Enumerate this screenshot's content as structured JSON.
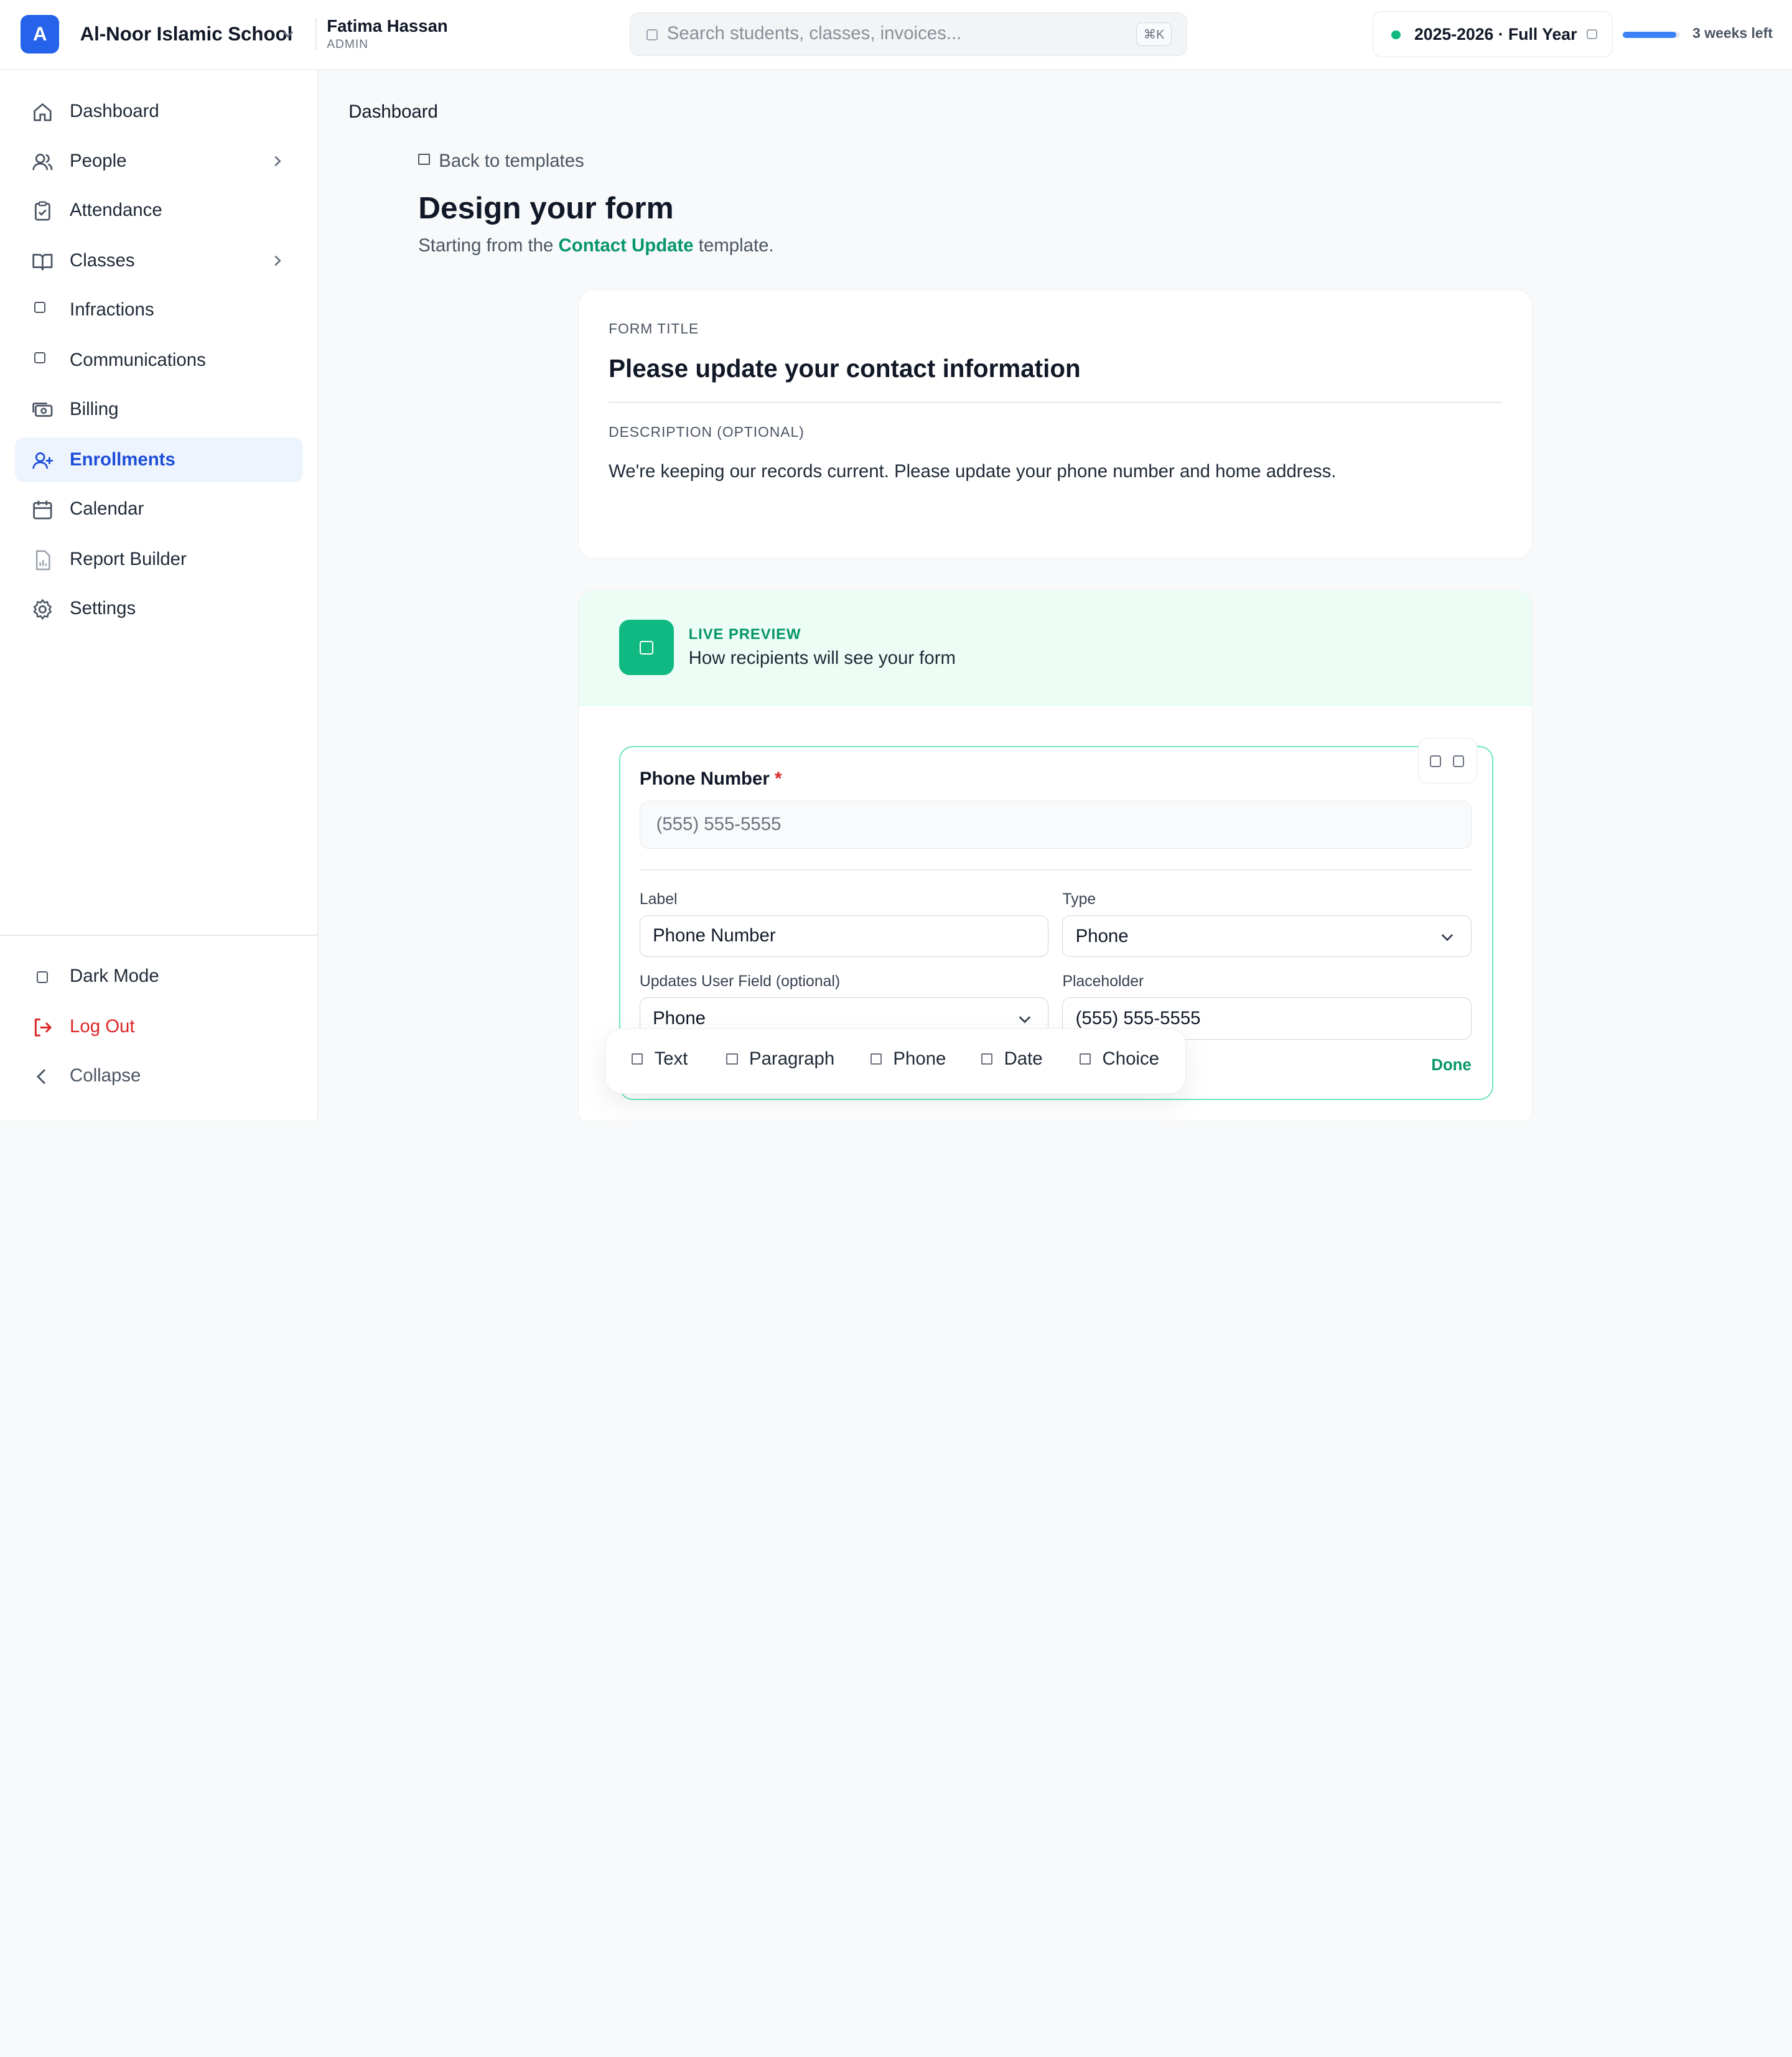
{
  "header": {
    "logo_letter": "A",
    "school_name": "Al-Noor Islamic School",
    "user_name": "Fatima Hassan",
    "user_role": "ADMIN",
    "search_placeholder": "Search students, classes, invoices...",
    "search_shortcut": "⌘K",
    "school_year": "2025-2026 · Full Year",
    "year_status_color": "#10b981",
    "term_progress_fraction": 0.93,
    "weeks_left": "3 weeks left"
  },
  "sidebar": {
    "items": [
      {
        "label": "Dashboard",
        "icon": "home-icon"
      },
      {
        "label": "People",
        "icon": "users-icon"
      },
      {
        "label": "Attendance",
        "icon": "clipboard-check-icon"
      },
      {
        "label": "Classes",
        "icon": "book-open-icon"
      },
      {
        "label": "Infractions",
        "icon": "square-icon"
      },
      {
        "label": "Communications",
        "icon": "square-icon"
      },
      {
        "label": "Billing",
        "icon": "banknote-icon"
      },
      {
        "label": "Enrollments",
        "icon": "user-plus-icon",
        "active": true
      },
      {
        "label": "Calendar",
        "icon": "calendar-icon"
      },
      {
        "label": "Report Builder",
        "icon": "file-chart-icon"
      },
      {
        "label": "Settings",
        "icon": "gear-icon"
      }
    ],
    "dark_mode": "Dark Mode",
    "log_out": "Log Out",
    "collapse": "Collapse"
  },
  "main": {
    "breadcrumb": "Dashboard",
    "back_link": "Back to templates",
    "title": "Design your form",
    "subtitle_prefix": "Starting from the",
    "template_name": "Contact Update",
    "subtitle_suffix": "template.",
    "form_title_caption": "FORM TITLE",
    "form_title": "Please update your contact information",
    "description_caption": "DESCRIPTION (OPTIONAL)",
    "description": "We're keeping our records current. Please update your phone number and home address.",
    "preview": {
      "kicker": "LIVE PREVIEW",
      "desc": "How recipients will see your form"
    },
    "field": {
      "label": "Phone Number",
      "required_mark": "*",
      "placeholder": "(555) 555-5555",
      "label_caption": "Label",
      "label_value": "Phone Number",
      "type_caption": "Type",
      "type_value": "Phone",
      "updates_caption": "Updates User Field (optional)",
      "updates_value": "Phone",
      "placeholder_caption": "Placeholder",
      "placeholder_value": "(555) 555-5555",
      "done": "Done"
    },
    "add_toolbar": [
      "Text",
      "Paragraph",
      "Phone",
      "Date",
      "Choice"
    ]
  }
}
